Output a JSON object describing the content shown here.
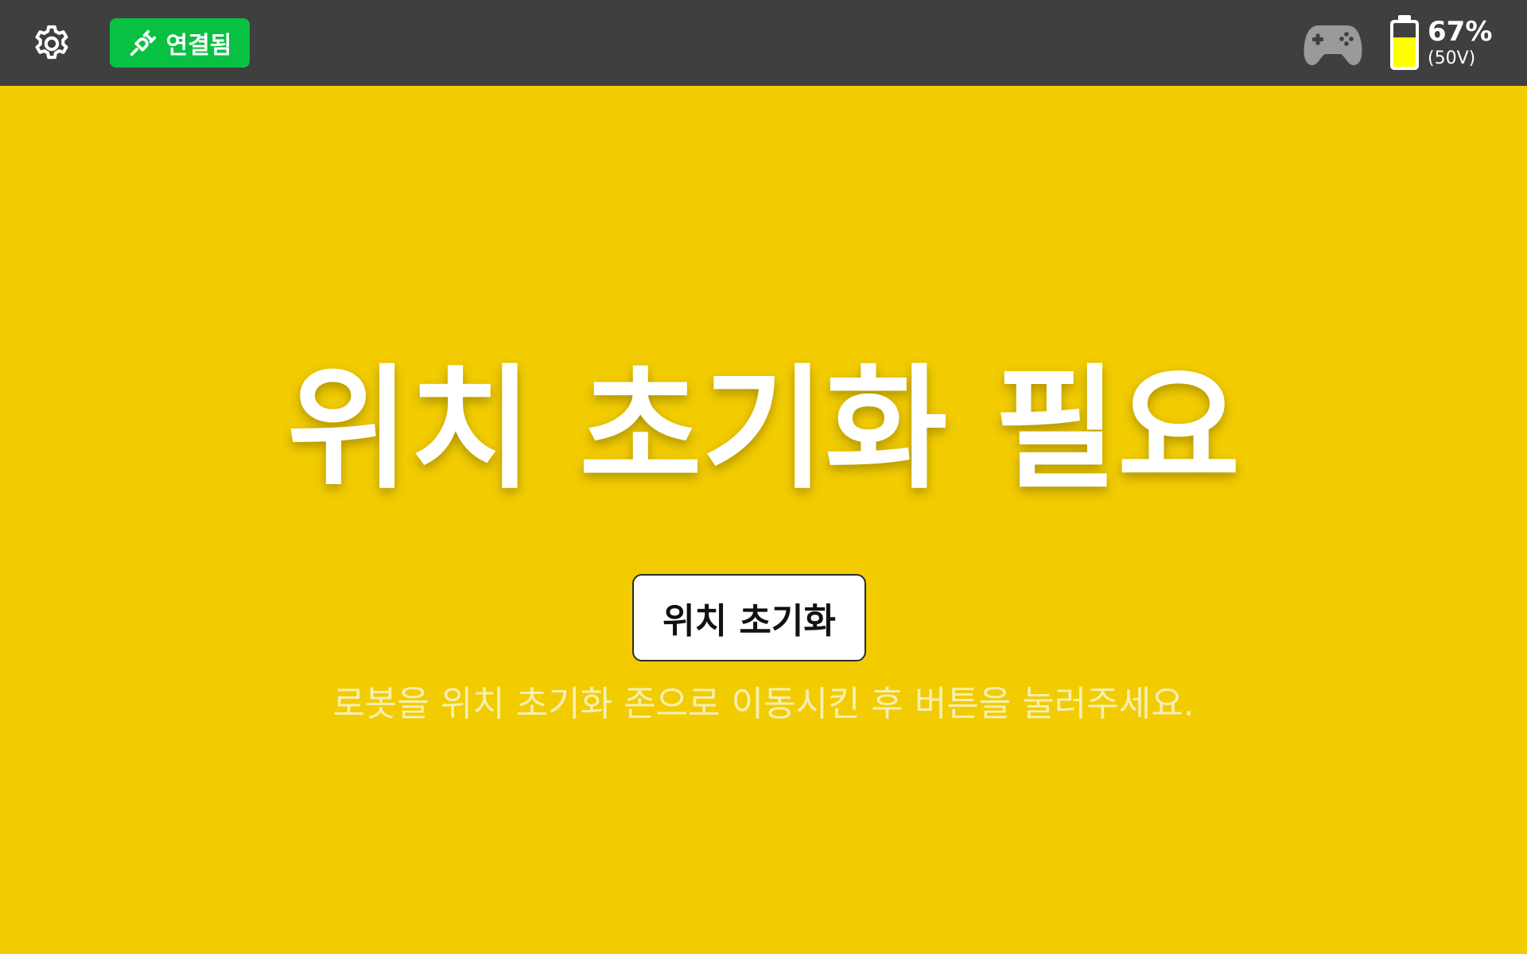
{
  "topbar": {
    "settings_icon": "gear-icon",
    "connection": {
      "label": "연결됨",
      "icon": "plug-icon",
      "color": "#08c143"
    },
    "controller_icon": "gamepad-icon",
    "battery": {
      "icon": "battery-icon",
      "percent_text": "67%",
      "voltage_text": "(50V)",
      "level": 0.67,
      "fill_color": "#ffff00"
    }
  },
  "main": {
    "title": "위치 초기화 필요",
    "button_label": "위치 초기화",
    "hint": "로봇을 위치 초기화 존으로 이동시킨 후 버튼을 눌러주세요."
  },
  "colors": {
    "background": "#f2cc00",
    "topbar": "#3f3f3f"
  }
}
